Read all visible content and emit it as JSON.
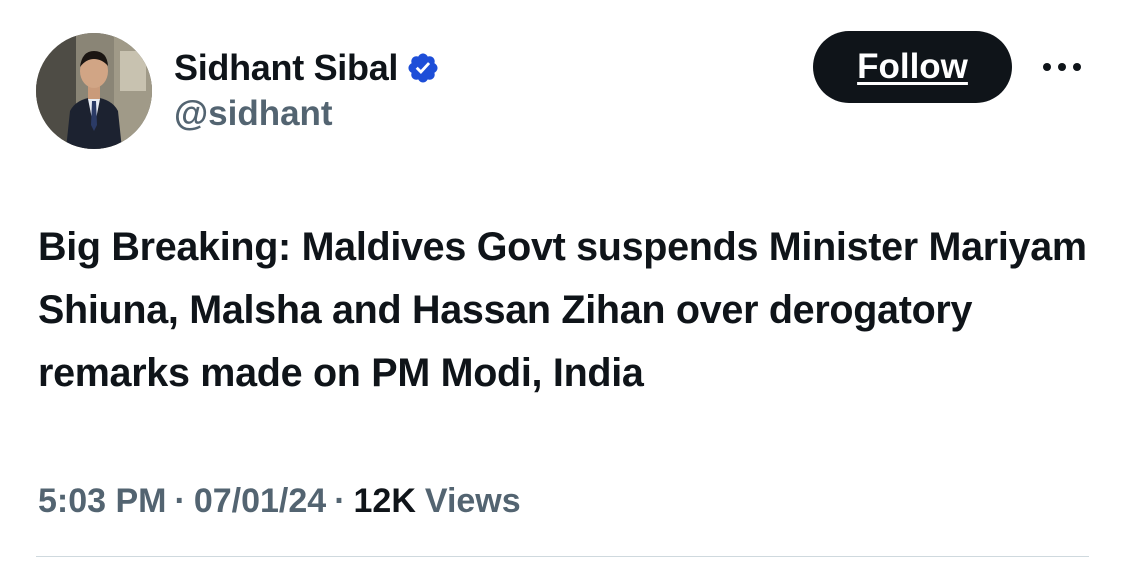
{
  "author": {
    "display_name": "Sidhant Sibal",
    "handle": "@sidhant",
    "verified": true,
    "verified_color": "#1d4ed8"
  },
  "actions": {
    "follow_label": "Follow",
    "more_icon": "more-horizontal-icon"
  },
  "tweet": {
    "text": "Big Breaking: Maldives Govt suspends Minister Mariyam Shiuna, Malsha and Hassan Zihan over derogatory remarks made on PM Modi, India"
  },
  "meta": {
    "time": "5:03 PM",
    "separator": "·",
    "date": "07/01/24",
    "views_count": "12K",
    "views_label": "Views"
  },
  "colors": {
    "text_primary": "#0f1419",
    "text_secondary": "#536471",
    "follow_bg": "#0f1419",
    "follow_text": "#ffffff",
    "divider": "#cfd9de"
  }
}
